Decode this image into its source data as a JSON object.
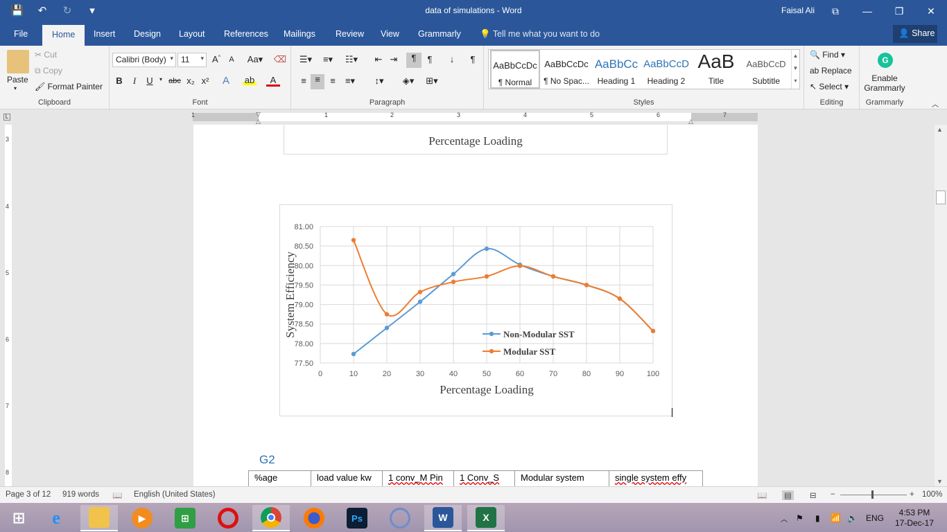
{
  "titlebar": {
    "doc_title": "data of simulations  -  Word",
    "user": "Faisal Ali",
    "qat": {
      "save_glyph": "💾",
      "undo_glyph": "↶",
      "redo_glyph": "↻",
      "customize_glyph": "▾"
    },
    "win": {
      "ribbon_display": "⧉",
      "minimize": "—",
      "restore": "❐",
      "close": "✕"
    }
  },
  "tabs": {
    "file": "File",
    "home": "Home",
    "insert": "Insert",
    "design": "Design",
    "layout": "Layout",
    "references": "References",
    "mailings": "Mailings",
    "review": "Review",
    "view": "View",
    "grammarly": "Grammarly",
    "tell_me": "Tell me what you want to do",
    "share": "Share"
  },
  "clipboard": {
    "paste": "Paste",
    "cut": "Cut",
    "copy": "Copy",
    "format_painter": "Format Painter",
    "label": "Clipboard"
  },
  "font": {
    "family": "Calibri (Body)",
    "size": "11",
    "label": "Font",
    "bold": "B",
    "italic": "I",
    "underline": "U",
    "strike": "abc",
    "sub": "x₂",
    "sup": "x²"
  },
  "paragraph": {
    "label": "Paragraph"
  },
  "styles": {
    "label": "Styles",
    "items": [
      {
        "preview": "AaBbCcDc",
        "name": "¶ Normal"
      },
      {
        "preview": "AaBbCcDc",
        "name": "¶ No Spac..."
      },
      {
        "preview": "AaBbCc",
        "name": "Heading 1"
      },
      {
        "preview": "AaBbCcD",
        "name": "Heading 2"
      },
      {
        "preview": "AaB",
        "name": "Title"
      },
      {
        "preview": "AaBbCcD",
        "name": "Subtitle"
      }
    ]
  },
  "editing": {
    "find": "Find",
    "replace": "Replace",
    "select": "Select",
    "label": "Editing"
  },
  "grammarly_grp": {
    "enable": "Enable",
    "grammarly": "Grammarly",
    "label": "Grammarly"
  },
  "ruler": {
    "h_numbers": [
      "1",
      "1",
      "2",
      "3",
      "4",
      "5",
      "6",
      "7"
    ],
    "v_numbers": [
      "3",
      "4",
      "5",
      "6",
      "7",
      "8"
    ]
  },
  "prev_chart": {
    "xlabel": "Percentage Loading",
    "ticks": [
      "0",
      "10",
      "20",
      "30",
      "40",
      "50",
      "60",
      "70",
      "80",
      "90",
      "100"
    ]
  },
  "chart_data": {
    "type": "line",
    "x": [
      10,
      20,
      30,
      40,
      50,
      60,
      70,
      80,
      90,
      100
    ],
    "series": [
      {
        "name": "Non-Modular SST",
        "color": "#5b9bd5",
        "values": [
          77.73,
          78.4,
          79.07,
          79.78,
          80.43,
          80.02,
          79.72,
          79.5,
          79.15,
          78.32
        ]
      },
      {
        "name": "Modular SST",
        "color": "#ed7d31",
        "values": [
          80.65,
          78.75,
          79.32,
          79.58,
          79.72,
          79.99,
          79.72,
          79.5,
          79.15,
          78.32
        ]
      }
    ],
    "xlabel": "Percentage Loading",
    "ylabel": "System Efficiency",
    "xlim": [
      0,
      100
    ],
    "ylim": [
      77.5,
      81.0
    ],
    "xticks": [
      "0",
      "10",
      "20",
      "30",
      "40",
      "50",
      "60",
      "70",
      "80",
      "90",
      "100"
    ],
    "yticks": [
      "77.50",
      "78.00",
      "78.50",
      "79.00",
      "79.50",
      "80.00",
      "80.50",
      "81.00"
    ],
    "grid": true,
    "legend_position": "bottom-right"
  },
  "doc": {
    "heading": "G2",
    "table_headers": [
      "%age",
      "load value kw",
      "1 conv_M Pin",
      "1 Conv_S",
      "Modular system",
      "single  system effy"
    ]
  },
  "statusbar": {
    "page": "Page 3 of 12",
    "words": "919 words",
    "language": "English (United States)",
    "zoom": "100%"
  },
  "taskbar": {
    "lang": "ENG",
    "time": "4:53 PM",
    "date": "17-Dec-17"
  }
}
